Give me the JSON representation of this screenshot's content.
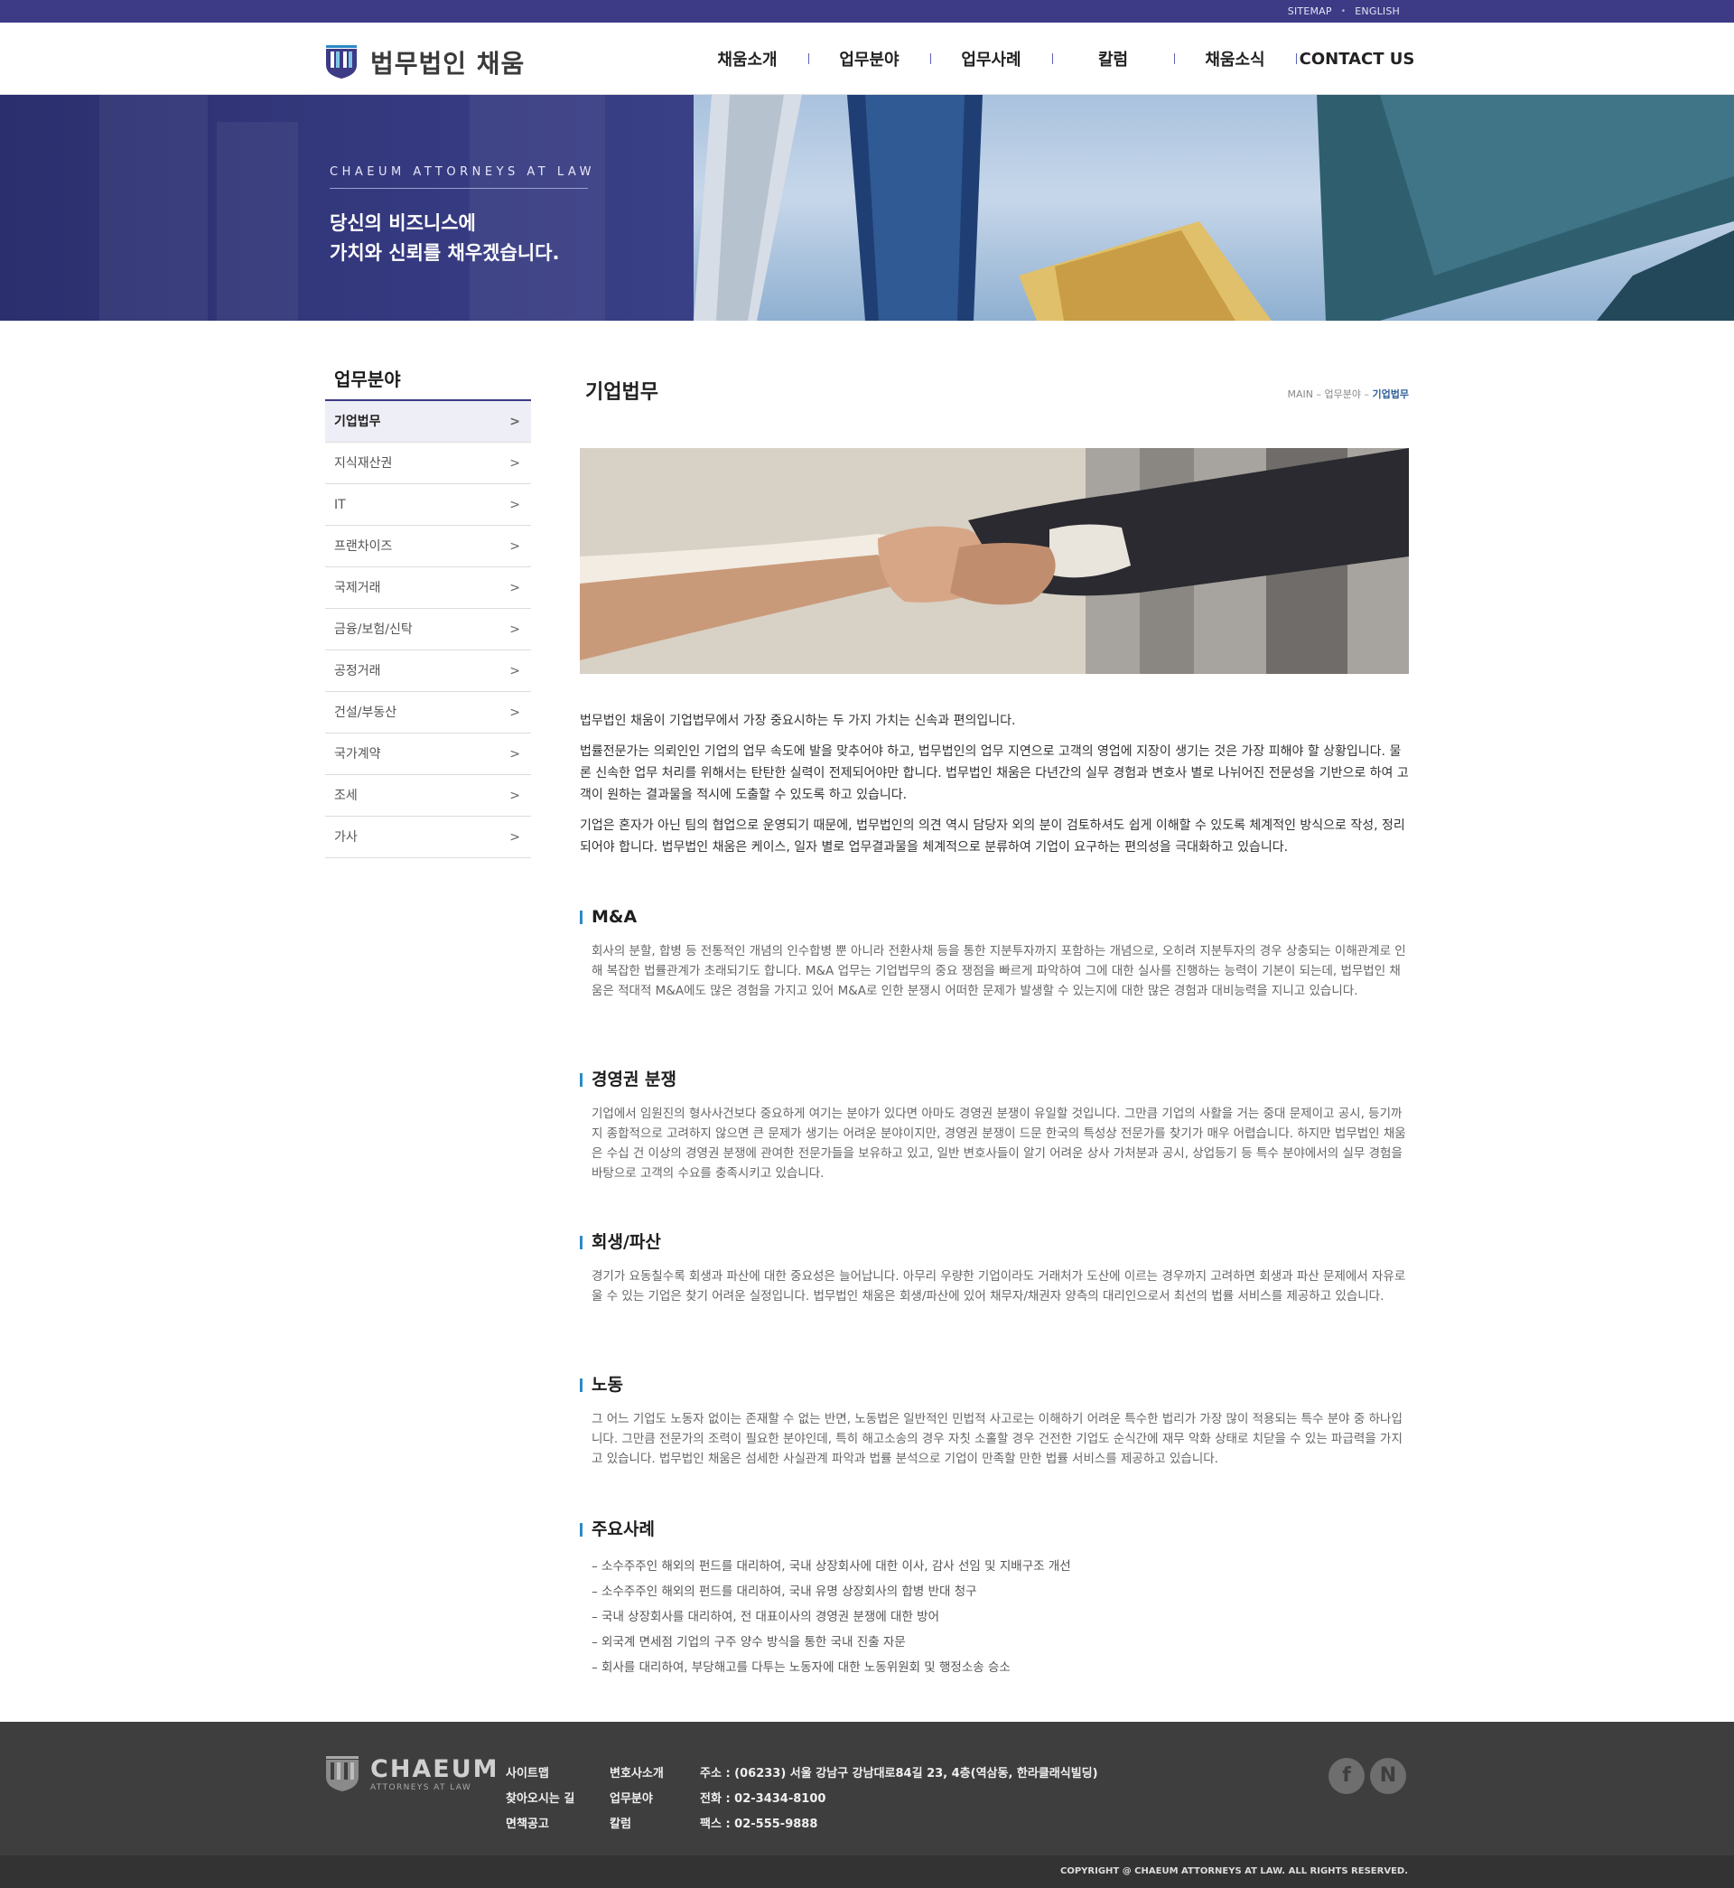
{
  "util": {
    "sitemap": "SITEMAP",
    "english": "ENGLISH"
  },
  "header": {
    "logo_text": "법무법인 채움",
    "nav": [
      "채움소개",
      "업무분야",
      "업무사례",
      "칼럼",
      "채움소식",
      "CONTACT US"
    ]
  },
  "hero": {
    "eyebrow": "CHAEUM ATTORNEYS AT LAW",
    "title_line1": "당신의 비즈니스에",
    "title_line2": "가치와 신뢰를 채우겠습니다."
  },
  "lnb": {
    "title": "업무분야",
    "items": [
      "기업법무",
      "지식재산권",
      "IT",
      "프랜차이즈",
      "국제거래",
      "금융/보험/신탁",
      "공정거래",
      "건설/부동산",
      "국가계약",
      "조세",
      "가사"
    ]
  },
  "content": {
    "title": "기업법무",
    "breadcrumb": {
      "home": "MAIN",
      "sep": "–",
      "parent": "업무분야",
      "current": "기업법무"
    },
    "intro": [
      "법무법인 채움이 기업법무에서 가장 중요시하는 두 가지 가치는 신속과 편의입니다.",
      "법률전문가는 의뢰인인 기업의 업무 속도에 발을 맞추어야 하고, 법무법인의 업무 지연으로 고객의 영업에 지장이 생기는 것은 가장 피해야 할 상황입니다. 물론 신속한 업무 처리를 위해서는 탄탄한 실력이 전제되어야만 합니다. 법무법인 채움은 다년간의 실무 경험과 변호사 별로 나뉘어진 전문성을 기반으로 하여 고객이 원하는 결과물을 적시에 도출할 수 있도록 하고 있습니다.",
      "기업은 혼자가 아닌 팀의 협업으로 운영되기 때문에, 법무법인의 의견 역시 담당자 외의 분이 검토하셔도 쉽게 이해할 수 있도록 체계적인 방식으로 작성, 정리되어야 합니다. 법무법인 채움은 케이스, 일자 별로 업무결과물을 체계적으로 분류하여 기업이 요구하는 편의성을 극대화하고 있습니다."
    ],
    "sections": [
      {
        "title": "M&A",
        "body": "회사의 분할, 합병 등 전통적인 개념의 인수합병 뿐 아니라 전환사채 등을 통한 지분투자까지 포함하는 개념으로, 오히려 지분투자의 경우 상충되는 이해관계로 인해 복잡한 법률관계가 초래되기도 합니다. M&A 업무는 기업법무의 중요 쟁점을 빠르게 파악하여 그에 대한 실사를 진행하는 능력이 기본이 되는데, 법무법인 채움은 적대적 M&A에도 많은 경험을 가지고 있어 M&A로 인한 분쟁시 어떠한 문제가 발생할 수 있는지에 대한 많은 경험과 대비능력을 지니고 있습니다."
      },
      {
        "title": "경영권 분쟁",
        "body": "기업에서 임원진의 형사사건보다 중요하게 여기는 분야가 있다면 아마도 경영권 분쟁이 유일할 것입니다. 그만큼 기업의 사활을 거는 중대 문제이고 공시, 등기까지 종합적으로 고려하지 않으면 큰 문제가 생기는 어려운 분야이지만, 경영권 분쟁이 드문 한국의 특성상 전문가를 찾기가 매우 어렵습니다. 하지만 법무법인 채움은 수십 건 이상의 경영권 분쟁에 관여한 전문가들을 보유하고 있고, 일반 변호사들이 알기 어려운 상사 가처분과 공시, 상업등기 등 특수 분야에서의 실무 경험을 바탕으로 고객의 수요를 충족시키고 있습니다."
      },
      {
        "title": "회생/파산",
        "body": "경기가 요동칠수록 회생과 파산에 대한 중요성은 늘어납니다. 아무리 우량한 기업이라도 거래처가 도산에 이르는 경우까지 고려하면 회생과 파산 문제에서 자유로울 수 있는 기업은 찾기 어려운 실정입니다. 법무법인 채움은 회생/파산에 있어 채무자/채권자 양측의 대리인으로서 최선의 법률 서비스를 제공하고 있습니다."
      },
      {
        "title": "노동",
        "body": "그 어느 기업도 노동자 없이는 존재할 수 없는 반면, 노동법은 일반적인 민법적 사고로는 이해하기 어려운 특수한 법리가 가장 많이 적용되는 특수 분야 중 하나입니다. 그만큼 전문가의 조력이 필요한 분야인데, 특히 해고소송의 경우 자칫 소홀할 경우 건전한 기업도 순식간에 재무 악화 상태로 치닫을 수 있는 파급력을 가지고 있습니다. 법무법인 채움은 섬세한 사실관계 파악과 법률 분석으로 기업이 만족할 만한 법률 서비스를 제공하고 있습니다."
      }
    ],
    "cases_title": "주요사례",
    "cases": [
      "소수주주인 해외의 펀드를 대리하여, 국내 상장회사에 대한 이사, 감사 선임 및 지배구조 개선",
      "소수주주인 해외의 펀드를 대리하여, 국내 유명 상장회사의 합병 반대 청구",
      "국내 상장회사를 대리하여, 전 대표이사의 경영권 분쟁에 대한 방어",
      "외국계 면세점 기업의 구주 양수 방식을 통한 국내 진출 자문",
      "회사를 대리하여, 부당해고를 다투는 노동자에 대한 노동위원회 및 행정소송 승소"
    ]
  },
  "footer": {
    "brand": "CHAEUM",
    "brand_sub": "ATTORNEYS AT LAW",
    "col1": [
      "사이트맵",
      "찾아오시는 길",
      "면책공고"
    ],
    "col2": [
      "변호사소개",
      "업무분야",
      "칼럼"
    ],
    "address": "주소 : (06233) 서울 강남구 강남대로84길 23, 4층(역삼동, 한라클래식빌딩)",
    "phone": "전화 : 02-3434-8100",
    "fax": "팩스 : 02-555-9888",
    "sns_facebook": "f",
    "sns_naver": "N",
    "copyright": "COPYRIGHT @ CHAEUM ATTORNEYS AT LAW. ALL RIGHTS RESERVED."
  }
}
